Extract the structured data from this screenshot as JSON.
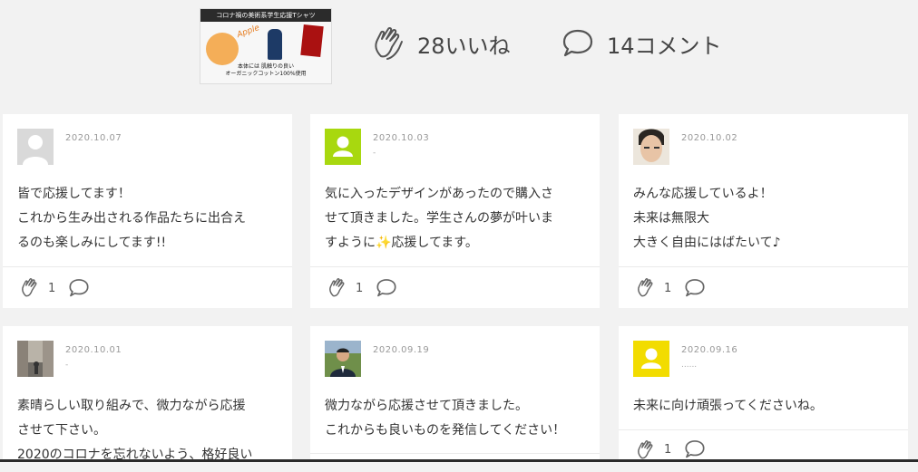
{
  "header": {
    "thumbnail": {
      "title": "コロナ禍の美術系学生応援Tシャツ",
      "brand": "Apple",
      "footer_line1": "本体には 肌触りの良い",
      "footer_line2": "オーガニックコットン100%使用"
    },
    "likes_label": "28いいね",
    "comments_label": "14コメント"
  },
  "icons": {
    "like": "clap-icon",
    "comment": "speech-bubble-icon"
  },
  "colors": {
    "page_bg": "#f2f2f2",
    "avatar_green": "#a8d80f",
    "avatar_yellow": "#f2dc00",
    "avatar_gray": "#d9d9d9"
  },
  "comments": [
    {
      "date": "2020.10.07",
      "name": "",
      "avatar": "default-gray",
      "lines": [
        "皆で応援してます！",
        "これから生み出される作品たちに出合え",
        "るのも楽しみにしてます!!"
      ],
      "likes": "1"
    },
    {
      "date": "2020.10.03",
      "name": "-",
      "avatar": "default-green",
      "lines": [
        "気に入ったデザインがあったので購入さ",
        "せて頂きました。学生さんの夢が叶いま",
        "すように✨応援してます。"
      ],
      "likes": "1"
    },
    {
      "date": "2020.10.02",
      "name": "",
      "avatar": "photo-face",
      "lines": [
        "みんな応援しているよ！",
        "未来は無限大",
        "大きく自由にはばたいて♪"
      ],
      "likes": "1"
    },
    {
      "date": "2020.10.01",
      "name": "-",
      "avatar": "photo-street",
      "lines": [
        "素晴らしい取り組みで、微力ながら応援",
        "させて下さい。",
        "2020のコロナを忘れないよう、格好良い"
      ],
      "likes": ""
    },
    {
      "date": "2020.09.19",
      "name": "",
      "avatar": "photo-man",
      "lines": [
        "微力ながら応援させて頂きました。",
        "これからも良いものを発信してください！"
      ],
      "likes": ""
    },
    {
      "date": "2020.09.16",
      "name": "......",
      "avatar": "default-yellow",
      "lines": [
        "未来に向け頑張ってくださいね。"
      ],
      "likes": "1"
    }
  ]
}
